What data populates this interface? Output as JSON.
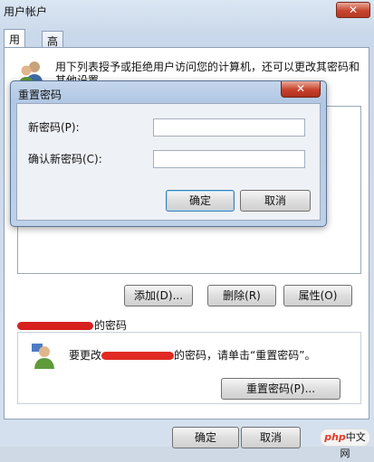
{
  "window": {
    "title": "用户帐户",
    "close_symbol": "✕"
  },
  "tabs": [
    {
      "label": "用户"
    },
    {
      "label": "高级"
    }
  ],
  "panel": {
    "description": "用下列表授予或拒绝用户访问您的计算机，还可以更改其密码和其他设置。",
    "buttons": {
      "add": "添加(D)...",
      "delete": "删除(R)",
      "properties": "属性(O)"
    },
    "password_section_suffix": "的密码",
    "reset_text_before": "要更改",
    "reset_text_after": "的密码，请单击“重置密码”。",
    "reset_button": "重置密码(P)..."
  },
  "footer": {
    "ok": "确定",
    "cancel": "取消"
  },
  "dialog": {
    "title": "重置密码",
    "close_symbol": "✕",
    "new_password_label": "新密码(P):",
    "new_password_value": "",
    "confirm_password_label": "确认新密码(C):",
    "confirm_password_value": "",
    "ok": "确定",
    "cancel": "取消"
  },
  "watermark": {
    "brand": "php",
    "text": "中文网"
  },
  "colors": {
    "redaction": "#d6211f",
    "default_button_border": "#3c7fb1"
  },
  "icons": {
    "users": "users-icon",
    "user": "user-icon"
  }
}
